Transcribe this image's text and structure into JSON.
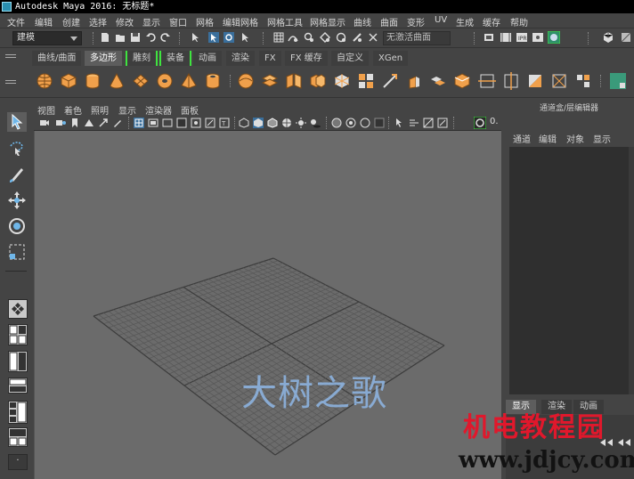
{
  "window": {
    "title": "Autodesk Maya 2016: 无标题*"
  },
  "menu": {
    "items": [
      "文件",
      "编辑",
      "创建",
      "选择",
      "修改",
      "显示",
      "窗口",
      "网格",
      "编辑网格",
      "网格工具",
      "网格显示",
      "曲线",
      "曲面",
      "变形",
      "UV",
      "生成",
      "缓存",
      "帮助"
    ]
  },
  "status_line": {
    "mode": "建模",
    "no_live_surface": "无激活曲面"
  },
  "shelf": {
    "tabs": [
      "曲线/曲面",
      "多边形",
      "雕刻",
      "装备",
      "动画",
      "渲染",
      "FX",
      "FX 缓存",
      "自定义",
      "XGen"
    ],
    "active_tab": "多边形"
  },
  "panel": {
    "menu": [
      "视图",
      "着色",
      "照明",
      "显示",
      "渲染器",
      "面板"
    ],
    "gamma_value": "0."
  },
  "viewport": {
    "watermark": "大树之歌"
  },
  "channel_box": {
    "title": "通道盒/层编辑器",
    "menu": [
      "通道",
      "编辑",
      "对象",
      "显示"
    ],
    "layer_tabs": [
      "显示",
      "渲染",
      "动画"
    ]
  },
  "branding": {
    "line1": "机电教程园",
    "line2": "www.jdjcy.com"
  },
  "colors": {
    "shelf_orange": "#f0a04b",
    "highlight_green": "#3fe33f",
    "brand_red": "#e0182c",
    "watermark_blue": "#8fb7e6"
  }
}
